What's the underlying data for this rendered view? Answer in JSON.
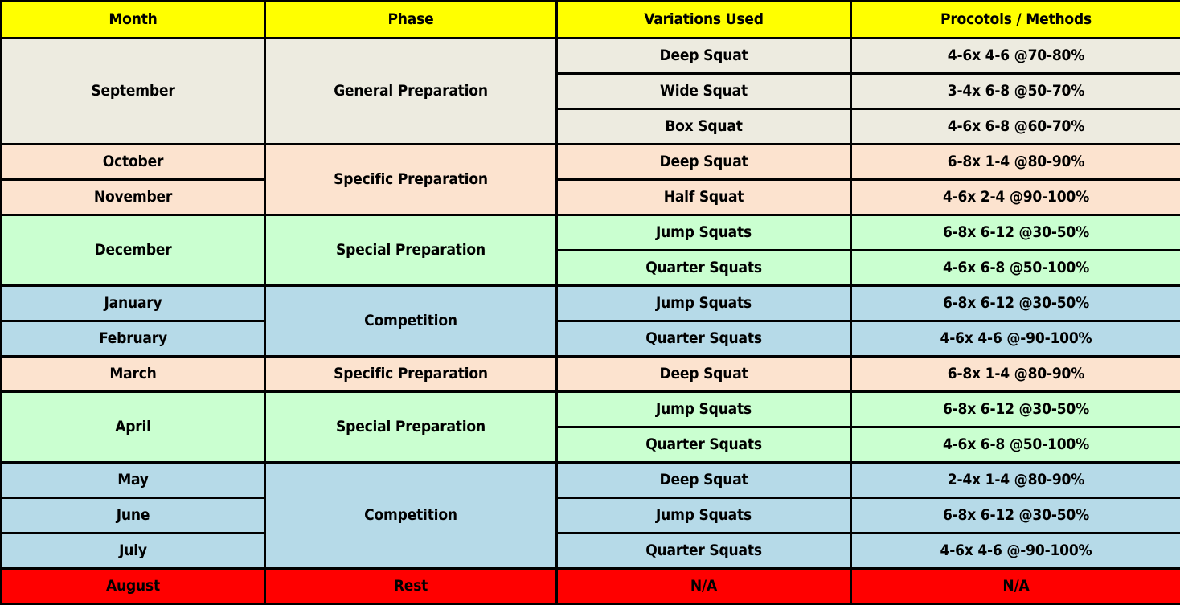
{
  "table": {
    "headers": [
      {
        "id": "month",
        "label": "Month"
      },
      {
        "id": "phase",
        "label": "Phase"
      },
      {
        "id": "variations",
        "label": "Variations Used"
      },
      {
        "id": "protocols",
        "label": "Procotols / Methods"
      }
    ],
    "colors": {
      "header_bg": "#FFFF00",
      "beige": "#EDEBE0",
      "peach": "#FCE3CF",
      "green": "#CAFFD0",
      "blue": "#B6DAE8",
      "red": "#FF0000",
      "text": "#000000",
      "border": "#000000"
    },
    "blocks": [
      {
        "color": "beige",
        "months": [
          "September"
        ],
        "phase": "General Preparation",
        "rows": [
          {
            "variation": "Deep Squat",
            "protocol": "4-6x 4-6 @70-80%"
          },
          {
            "variation": "Wide Squat",
            "protocol": "3-4x 6-8 @50-70%"
          },
          {
            "variation": "Box Squat",
            "protocol": "4-6x 6-8 @60-70%"
          }
        ]
      },
      {
        "color": "peach",
        "months": [
          "October",
          "November"
        ],
        "phase": "Specific Preparation",
        "rows": [
          {
            "variation": "Deep Squat",
            "protocol": "6-8x 1-4 @80-90%"
          },
          {
            "variation": "Half Squat",
            "protocol": "4-6x 2-4 @90-100%"
          }
        ]
      },
      {
        "color": "green",
        "months": [
          "December"
        ],
        "phase": "Special Preparation",
        "rows": [
          {
            "variation": "Jump Squats",
            "protocol": "6-8x 6-12 @30-50%"
          },
          {
            "variation": "Quarter Squats",
            "protocol": "4-6x 6-8 @50-100%"
          }
        ]
      },
      {
        "color": "blue",
        "months": [
          "January",
          "February"
        ],
        "phase": "Competition",
        "rows": [
          {
            "variation": "Jump Squats",
            "protocol": "6-8x 6-12 @30-50%"
          },
          {
            "variation": "Quarter Squats",
            "protocol": "4-6x 4-6 @-90-100%"
          }
        ]
      },
      {
        "color": "peach",
        "months": [
          "March"
        ],
        "phase": "Specific Preparation",
        "rows": [
          {
            "variation": "Deep Squat",
            "protocol": "6-8x 1-4 @80-90%"
          }
        ]
      },
      {
        "color": "green",
        "months": [
          "April"
        ],
        "phase": "Special Preparation",
        "rows": [
          {
            "variation": "Jump Squats",
            "protocol": "6-8x 6-12 @30-50%"
          },
          {
            "variation": "Quarter Squats",
            "protocol": "4-6x 6-8 @50-100%"
          }
        ]
      },
      {
        "color": "blue",
        "months": [
          "May",
          "June",
          "July"
        ],
        "phase": "Competition",
        "rows": [
          {
            "variation": "Deep Squat",
            "protocol": "2-4x 1-4 @80-90%"
          },
          {
            "variation": "Jump Squats",
            "protocol": "6-8x 6-12 @30-50%"
          },
          {
            "variation": "Quarter Squats",
            "protocol": "4-6x 4-6 @-90-100%"
          }
        ]
      },
      {
        "color": "red",
        "months": [
          "August"
        ],
        "phase": "Rest",
        "rows": [
          {
            "variation": "N/A",
            "protocol": "N/A"
          }
        ]
      }
    ]
  }
}
